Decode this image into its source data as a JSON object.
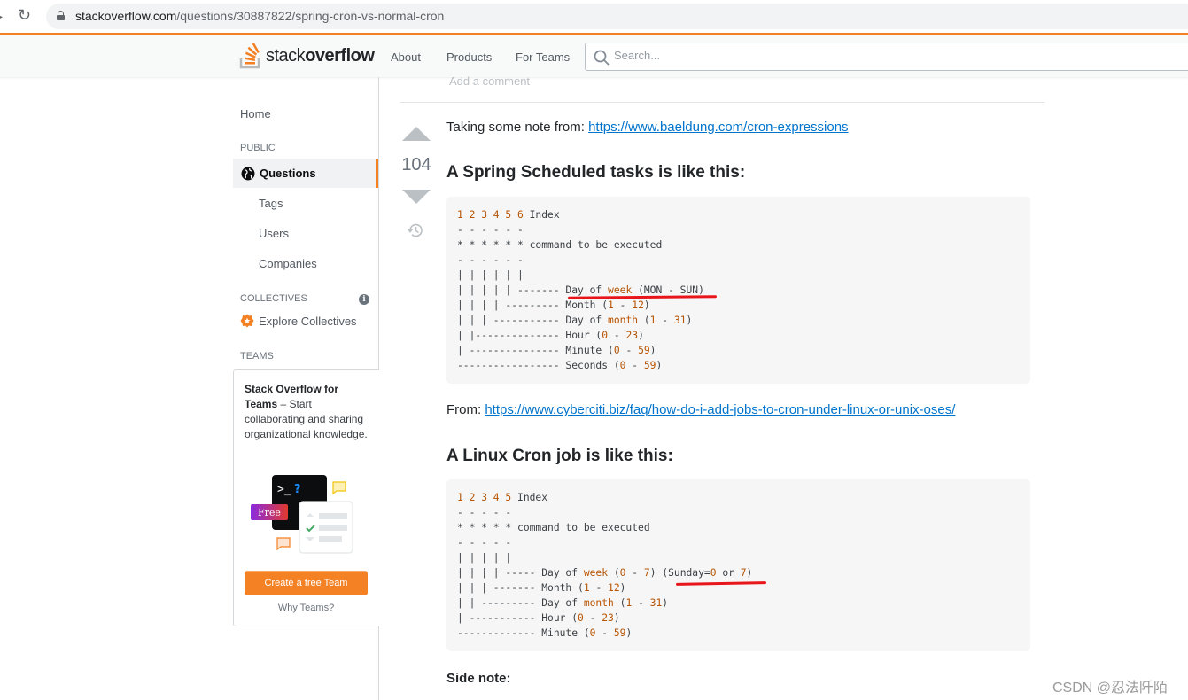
{
  "browser": {
    "url_host": "stackoverflow.com",
    "url_path": "/questions/30887822/spring-cron-vs-normal-cron"
  },
  "header": {
    "logo_light": "stack",
    "logo_bold": "overflow",
    "nav": [
      "About",
      "Products",
      "For Teams"
    ],
    "search_placeholder": "Search..."
  },
  "sidebar": {
    "home": "Home",
    "public_heading": "PUBLIC",
    "questions": "Questions",
    "tags": "Tags",
    "users": "Users",
    "companies": "Companies",
    "collectives_heading": "COLLECTIVES",
    "explore_collectives": "Explore Collectives",
    "teams_heading": "TEAMS",
    "teams_card": {
      "title": "Stack Overflow for Teams",
      "body": " – Start collaborating and sharing organizational knowledge.",
      "free_badge": "Free",
      "cta": "Create a free Team",
      "why": "Why Teams?"
    }
  },
  "answer": {
    "add_comment": "Add a comment",
    "votes": "104",
    "intro_text": "Taking some note from: ",
    "intro_link": "https://www.baeldung.com/cron-expressions",
    "spring_heading": "A Spring Scheduled tasks is like this:",
    "spring_code": [
      [
        [
          "n",
          "1 2 3 4 5 6"
        ],
        [
          "t",
          " Index"
        ]
      ],
      [
        [
          "t",
          "- - - - - -"
        ]
      ],
      [
        [
          "t",
          "* * * * * * command to be executed"
        ]
      ],
      [
        [
          "t",
          "- - - - - -"
        ]
      ],
      [
        [
          "t",
          "| | | | | |"
        ]
      ],
      [
        [
          "t",
          "| | | | | ------- Day of "
        ],
        [
          "n",
          "week"
        ],
        [
          "t",
          " (MON - SUN)"
        ]
      ],
      [
        [
          "t",
          "| | | | --------- Month ("
        ],
        [
          "n",
          "1"
        ],
        [
          "t",
          " - "
        ],
        [
          "n",
          "12"
        ],
        [
          "t",
          ")"
        ]
      ],
      [
        [
          "t",
          "| | | ----------- Day of "
        ],
        [
          "n",
          "month"
        ],
        [
          "t",
          " ("
        ],
        [
          "n",
          "1"
        ],
        [
          "t",
          " - "
        ],
        [
          "n",
          "31"
        ],
        [
          "t",
          ")"
        ]
      ],
      [
        [
          "t",
          "| |-------------- Hour ("
        ],
        [
          "n",
          "0"
        ],
        [
          "t",
          " - "
        ],
        [
          "n",
          "23"
        ],
        [
          "t",
          ")"
        ]
      ],
      [
        [
          "t",
          "| --------------- Minute ("
        ],
        [
          "n",
          "0"
        ],
        [
          "t",
          " - "
        ],
        [
          "n",
          "59"
        ],
        [
          "t",
          ")"
        ]
      ],
      [
        [
          "t",
          "----------------- Seconds ("
        ],
        [
          "n",
          "0"
        ],
        [
          "t",
          " - "
        ],
        [
          "n",
          "59"
        ],
        [
          "t",
          ")"
        ]
      ]
    ],
    "from_text": "From: ",
    "from_link": "https://www.cyberciti.biz/faq/how-do-i-add-jobs-to-cron-under-linux-or-unix-oses/",
    "linux_heading": "A Linux Cron job is like this:",
    "linux_code": [
      [
        [
          "n",
          "1 2 3 4 5"
        ],
        [
          "t",
          " Index"
        ]
      ],
      [
        [
          "t",
          "- - - - -"
        ]
      ],
      [
        [
          "t",
          "* * * * * command to be executed"
        ]
      ],
      [
        [
          "t",
          "- - - - -"
        ]
      ],
      [
        [
          "t",
          "| | | | |"
        ]
      ],
      [
        [
          "t",
          "| | | | ----- Day of "
        ],
        [
          "n",
          "week"
        ],
        [
          "t",
          " ("
        ],
        [
          "n",
          "0"
        ],
        [
          "t",
          " - "
        ],
        [
          "n",
          "7"
        ],
        [
          "t",
          ") (Sunday="
        ],
        [
          "n",
          "0"
        ],
        [
          "t",
          " or "
        ],
        [
          "n",
          "7"
        ],
        [
          "t",
          ")"
        ]
      ],
      [
        [
          "t",
          "| | | ------- Month ("
        ],
        [
          "n",
          "1"
        ],
        [
          "t",
          " - "
        ],
        [
          "n",
          "12"
        ],
        [
          "t",
          ")"
        ]
      ],
      [
        [
          "t",
          "| | --------- Day of "
        ],
        [
          "n",
          "month"
        ],
        [
          "t",
          " ("
        ],
        [
          "n",
          "1"
        ],
        [
          "t",
          " - "
        ],
        [
          "n",
          "31"
        ],
        [
          "t",
          ")"
        ]
      ],
      [
        [
          "t",
          "| ----------- Hour ("
        ],
        [
          "n",
          "0"
        ],
        [
          "t",
          " - "
        ],
        [
          "n",
          "23"
        ],
        [
          "t",
          ")"
        ]
      ],
      [
        [
          "t",
          "------------- Minute ("
        ],
        [
          "n",
          "0"
        ],
        [
          "t",
          " - "
        ],
        [
          "n",
          "59"
        ],
        [
          "t",
          ")"
        ]
      ]
    ],
    "side_note": "Side note:"
  },
  "watermark": "CSDN @忍法阡陌",
  "colors": {
    "accent": "#f48024",
    "link": "#0074cc",
    "code_number": "#b75301",
    "annotation_red": "#e8151b"
  }
}
